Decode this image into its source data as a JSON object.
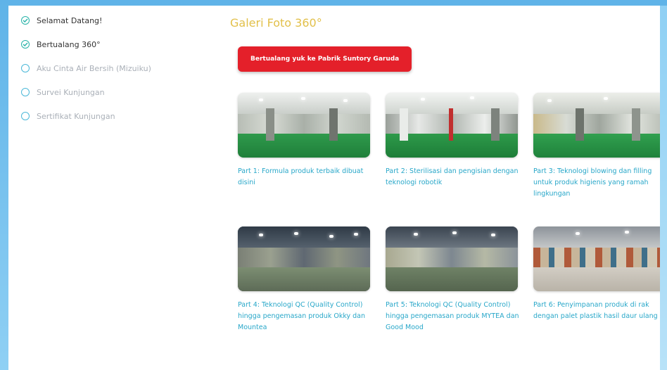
{
  "sidebar": {
    "steps": [
      {
        "label": "Selamat Datang!",
        "done": true
      },
      {
        "label": "Bertualang 360°",
        "done": true
      },
      {
        "label": "Aku Cinta Air Bersih (Mizuiku)",
        "done": false
      },
      {
        "label": "Survei Kunjungan",
        "done": false
      },
      {
        "label": "Sertifikat Kunjungan",
        "done": false
      }
    ]
  },
  "main": {
    "title": "Galeri Foto 360°",
    "cta_label": "Bertualang yuk ke Pabrik Suntory Garuda",
    "gallery": [
      {
        "caption": "Part 1: Formula produk terbaik dibuat disini",
        "theme": "green-floor"
      },
      {
        "caption": "Part 2: Sterilisasi dan pengisian dengan teknologi robotik",
        "theme": "green-floor"
      },
      {
        "caption": "Part 3: Teknologi blowing dan filling untuk produk higienis yang ramah lingkungan",
        "theme": "green-floor"
      },
      {
        "caption": "Part 4: Teknologi QC (Quality Control) hingga pengemasan produk Okky dan Mountea",
        "theme": "dark-floor"
      },
      {
        "caption": "Part 5: Teknologi QC (Quality Control) hingga pengemasan produk MYTEA dan Good Mood",
        "theme": "dark-floor"
      },
      {
        "caption": "Part 6: Penyimpanan produk di rak dengan palet plastik hasil daur ulang",
        "theme": "warehouse"
      }
    ]
  },
  "colors": {
    "accent_title": "#e2c04a",
    "cta_bg": "#e4202a",
    "caption": "#28a7c9",
    "check": "#27b3a8"
  }
}
